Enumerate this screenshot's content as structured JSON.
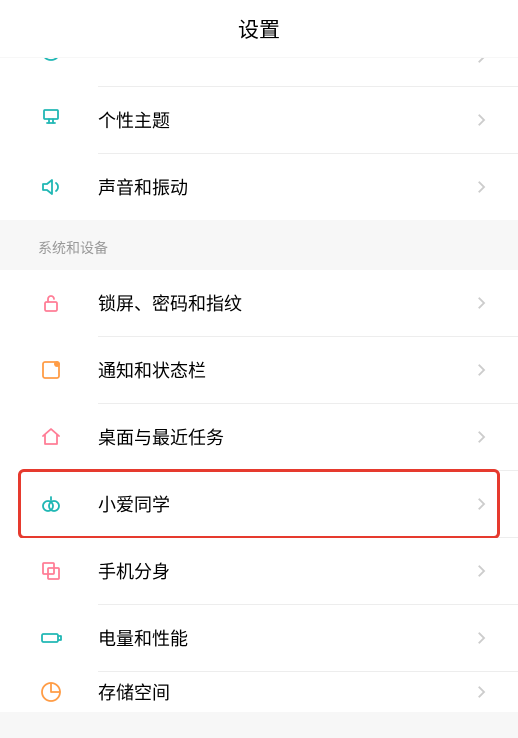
{
  "header": {
    "title": "设置"
  },
  "group1": {
    "items": [
      {
        "label": "个性主题"
      },
      {
        "label": "声音和振动"
      }
    ]
  },
  "group2": {
    "title": "系统和设备",
    "items": [
      {
        "label": "锁屏、密码和指纹"
      },
      {
        "label": "通知和状态栏"
      },
      {
        "label": "桌面与最近任务"
      },
      {
        "label": "小爱同学"
      },
      {
        "label": "手机分身"
      },
      {
        "label": "电量和性能"
      },
      {
        "label": "存储空间"
      }
    ]
  },
  "colors": {
    "accent": "#20b7b4",
    "chevron": "#cccccc",
    "iconPink": "#ff7d96",
    "iconOrange": "#ff9c45",
    "highlight": "#e63a2e"
  }
}
